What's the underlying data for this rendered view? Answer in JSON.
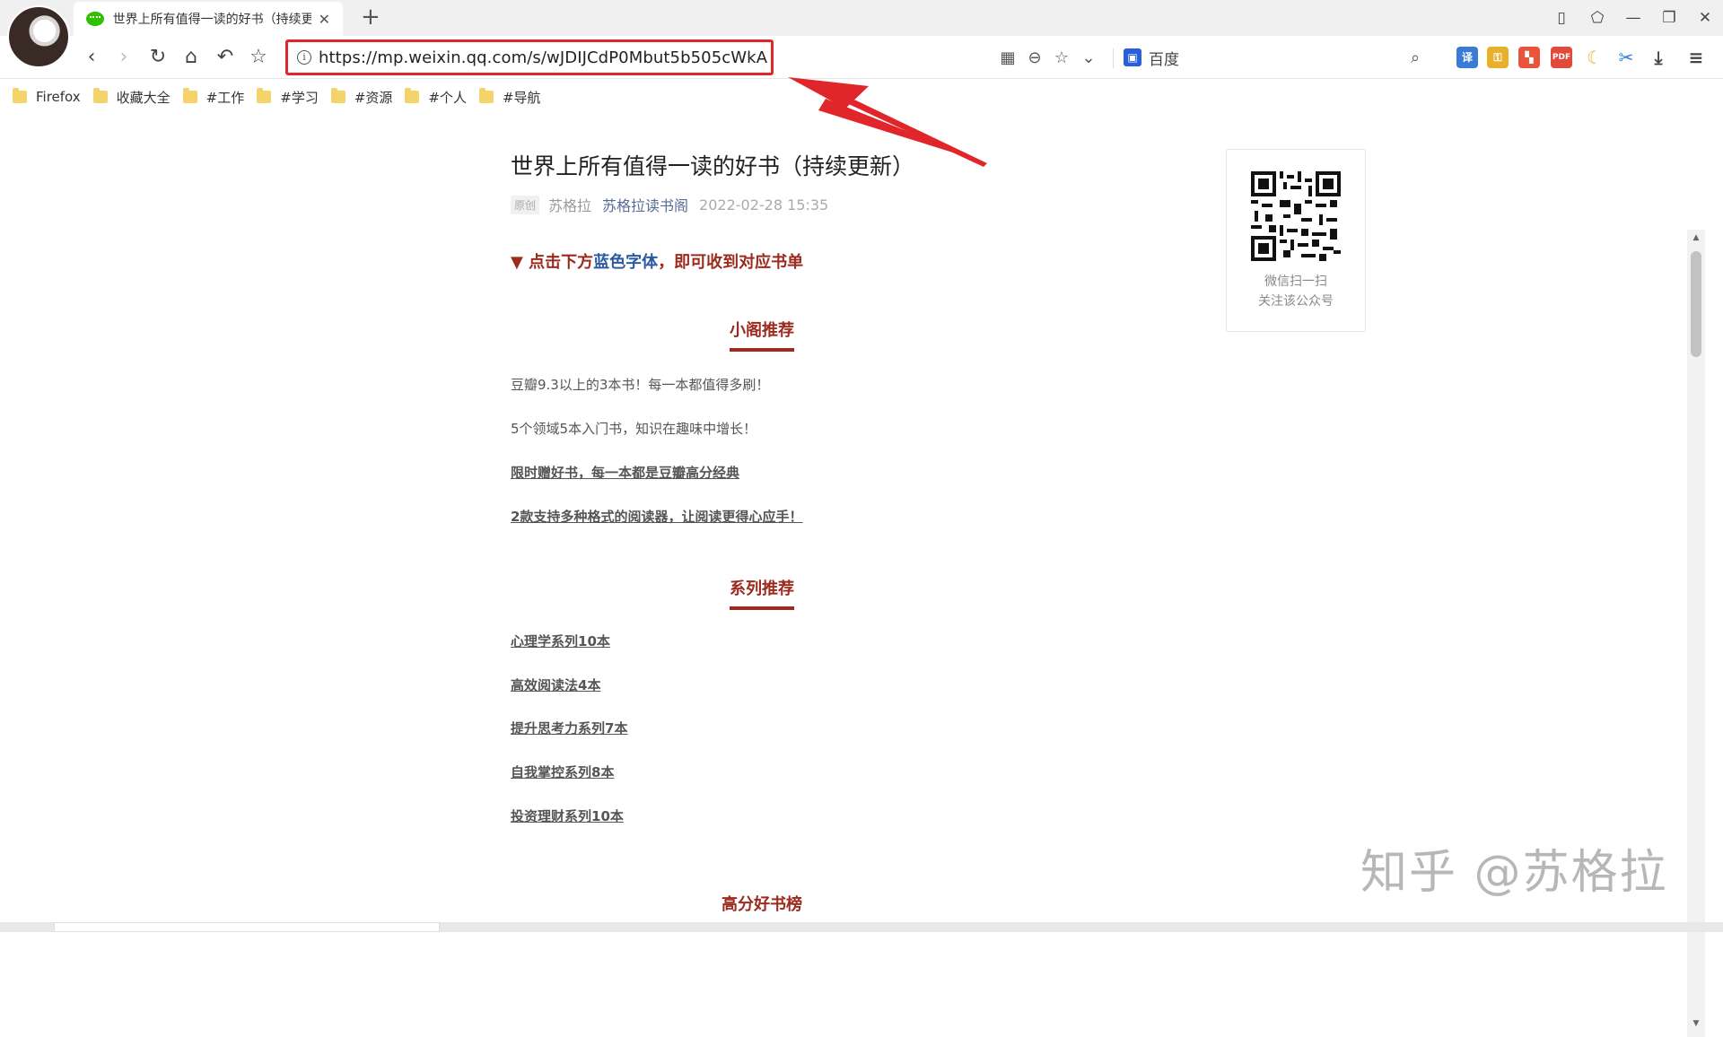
{
  "tab": {
    "title": "世界上所有值得一读的好书（持续更新）",
    "close": "✕",
    "new_tab": "+"
  },
  "window_controls": [
    "▯",
    "⬠",
    "—",
    "❐",
    "✕"
  ],
  "nav": {
    "back": "‹",
    "forward": "›",
    "reload": "↻",
    "home": "⌂",
    "undo": "↶",
    "star": "☆",
    "url": "https://mp.weixin.qq.com/s/wJDIJCdP0Mbut5b505cWkA",
    "search_engine": "百度",
    "search_icon": "⌕"
  },
  "bookmarks": [
    "Firefox",
    "收藏大全",
    "#工作",
    "#学习",
    "#资源",
    "#个人",
    "#导航"
  ],
  "article": {
    "title": "世界上所有值得一读的好书（持续更新）",
    "original_badge": "原创",
    "author": "苏格拉",
    "account": "苏格拉读书阁",
    "date": "2022-02-28 15:35",
    "prompt_prefix": "▼ 点击下方",
    "prompt_blue": "蓝色字体",
    "prompt_suffix": "，即可收到对应书单",
    "section1": {
      "heading": "小阁推荐",
      "lines": [
        "豆瓣9.3以上的3本书！每一本都值得多刷！",
        "5个领域5本入门书，知识在趣味中增长！"
      ],
      "links": [
        "限时赠好书，每一本都是豆瓣高分经典",
        "2款支持多种格式的阅读器，让阅读更得心应手！"
      ]
    },
    "section2": {
      "heading": "系列推荐",
      "links": [
        "心理学系列10本",
        "高效阅读法4本",
        "提升思考力系列7本",
        "自我掌控系列8本",
        "投资理财系列10本"
      ]
    },
    "section3": {
      "heading": "高分好书榜"
    }
  },
  "qr": {
    "caption_line1": "微信扫一扫",
    "caption_line2": "关注该公众号"
  },
  "watermark": "知乎 @苏格拉",
  "colors": {
    "accent": "#9c2a1f",
    "link_blue": "#2c5aa0",
    "highlight_red": "#e0262a"
  }
}
